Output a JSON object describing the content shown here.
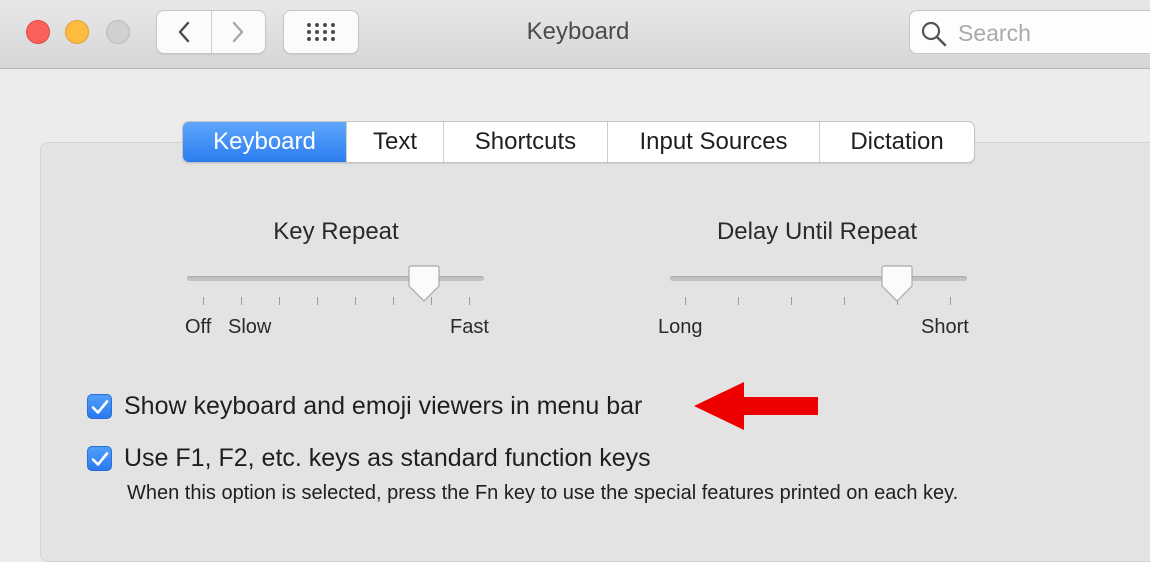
{
  "window": {
    "title": "Keyboard",
    "search_placeholder": "Search"
  },
  "icons": {
    "back": "chevron-left-icon",
    "forward": "chevron-right-icon",
    "show_all": "grid-icon",
    "search": "magnifier-icon",
    "annotation": "red-arrow-left"
  },
  "tabs": [
    {
      "label": "Keyboard",
      "active": true
    },
    {
      "label": "Text",
      "active": false
    },
    {
      "label": "Shortcuts",
      "active": false
    },
    {
      "label": "Input Sources",
      "active": false
    },
    {
      "label": "Dictation",
      "active": false
    }
  ],
  "key_repeat": {
    "title": "Key Repeat",
    "labels": {
      "off": "Off",
      "slow": "Slow",
      "fast": "Fast"
    },
    "tick_count": 8,
    "value_fraction": 0.83
  },
  "delay_until_repeat": {
    "title": "Delay Until Repeat",
    "labels": {
      "long": "Long",
      "short": "Short"
    },
    "tick_count": 6,
    "value_fraction": 0.8
  },
  "options": [
    {
      "label": "Show keyboard and emoji viewers in menu bar",
      "checked": true
    },
    {
      "label": "Use F1, F2, etc. keys as standard function keys",
      "checked": true
    }
  ],
  "fn_note": "When this option is selected, press the Fn key to use the special features printed on each key.",
  "colors": {
    "accent": "#2b7cf0",
    "close": "#fc605c",
    "minimize": "#fdbc40",
    "zoom_disabled": "#d0d0d0",
    "annotation_arrow": "#ee0000"
  }
}
